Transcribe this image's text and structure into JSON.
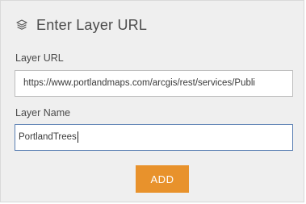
{
  "dialog": {
    "icon": "layers-icon",
    "title": "Enter Layer URL"
  },
  "fields": {
    "layer_url": {
      "label": "Layer URL",
      "value": "https://www.portlandmaps.com/arcgis/rest/services/Publi"
    },
    "layer_name": {
      "label": "Layer Name",
      "value": "PortlandTrees"
    }
  },
  "actions": {
    "add_label": "ADD",
    "add_color": "#e8922c"
  }
}
